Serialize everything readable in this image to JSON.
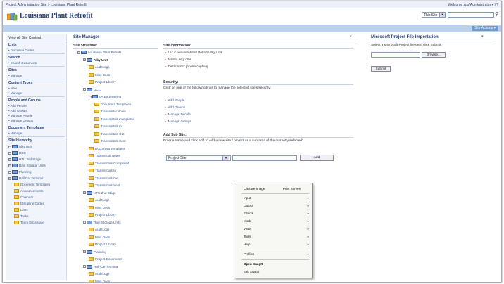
{
  "breadcrumb": "Project Administration Site > Louisiana Plant Retrofit",
  "welcome": "Welcome sps\\Administrator ▾ | ?",
  "site_title": "Louisiana Plant Retrofit",
  "search": {
    "scope": "This Site",
    "placeholder": ""
  },
  "site_actions": "Site Actions ▾",
  "leftnav": {
    "view_all": "View All Site Content",
    "lists": {
      "heading": "Lists",
      "items": [
        "Discipline Codes"
      ]
    },
    "search": {
      "heading": "Search",
      "items": [
        "Search Documents"
      ]
    },
    "sites": {
      "heading": "Sites",
      "items": [
        "Manage"
      ]
    },
    "content_types": {
      "heading": "Content Types",
      "items": [
        "New",
        "Manage"
      ]
    },
    "people_groups": {
      "heading": "People and Groups",
      "items": [
        "Add People",
        "Add Groups",
        "Manage People",
        "Manage Groups"
      ]
    },
    "doc_templates": {
      "heading": "Document Templates",
      "items": [
        "Manage"
      ]
    },
    "hierarchy": {
      "heading": "Site Hierarchy",
      "items": [
        "Alky Unit",
        "DCC",
        "HTU 2nd Stage",
        "Rain Storage Units",
        "Planning",
        "Rail Car Terminal",
        "Document Templates",
        "Announcements",
        "Calendar",
        "Discipline Codes",
        "Links",
        "Tasks",
        "Team Discussion"
      ]
    }
  },
  "site_manager": {
    "title": "Site Manager",
    "structure_label": "Site Structure:",
    "tree": [
      "Louisiana Plant Retrofit",
      "Alky Unit",
      "AuditLogs",
      "Misc Docs",
      "Project Library",
      "DCC",
      "LA Engineering",
      "Document Templates",
      "Transmittal Notes",
      "Transmittals Completed",
      "Transmittals In",
      "Transmittals Out",
      "Transmittals Sent",
      "Document Templates",
      "Transmittal Notes",
      "Transmittals Completed",
      "Transmittals In",
      "Transmittals Out",
      "Transmittals Sent",
      "HTU 2nd Stage",
      "AuditLogs",
      "Misc Docs",
      "Project Library",
      "Rain Storage Units",
      "AuditLogs",
      "Misc Docs",
      "Project Library",
      "Planning",
      "Project Documents",
      "Rail Car Terminal",
      "AuditLogs",
      "Misc Docs"
    ],
    "info_label": "Site Information:",
    "info": [
      "Url: /Louisiana Plant Retrofit/Alky Unit",
      "Name: Alky Unit",
      "Description: [no description]"
    ],
    "security_label": "Security:",
    "security_text": "Click on one of the following links to manage the selected site's security:",
    "security_links": [
      "Add People",
      "Add Groups",
      "Manage People",
      "Manage Groups"
    ],
    "subsite_label": "Add Sub Site:",
    "subsite_text": "Enter a name and click Add to add a new site / project as a sub area of the currently selected:",
    "subsite_select": "Project Site",
    "add_button": "Add"
  },
  "msp_import": {
    "title": "Microsoft Project File Importation",
    "text": "Select a Microsoft Project file then click Submit.",
    "browse_button": "Browse...",
    "submit_button": "Submit"
  },
  "context_menu": {
    "capture": "Capture Image",
    "capture_shortcut": "Print Screen",
    "items": [
      "Input",
      "Output",
      "Effects",
      "Mode",
      "View",
      "Tools",
      "Help"
    ],
    "profiles": "Profiles",
    "open": "Open SnagIt",
    "exit": "Exit SnagIt"
  }
}
